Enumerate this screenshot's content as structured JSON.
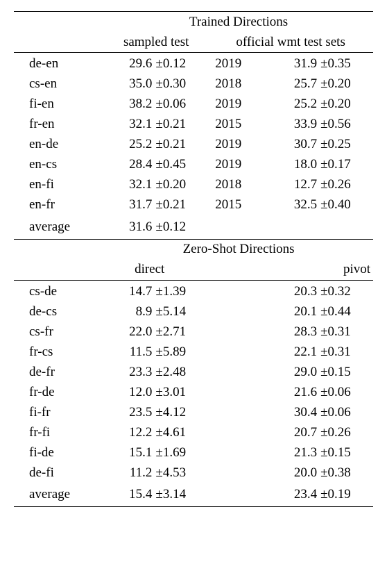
{
  "trained": {
    "title": "Trained Directions",
    "col_sampled": "sampled test",
    "col_official": "official wmt test sets",
    "rows": [
      {
        "pair": "de-en",
        "sv": "29.6",
        "se": "±0.12",
        "yr": "2019",
        "ov": "31.9",
        "oe": "±0.35"
      },
      {
        "pair": "cs-en",
        "sv": "35.0",
        "se": "±0.30",
        "yr": "2018",
        "ov": "25.7",
        "oe": "±0.20"
      },
      {
        "pair": "fi-en",
        "sv": "38.2",
        "se": "±0.06",
        "yr": "2019",
        "ov": "25.2",
        "oe": "±0.20"
      },
      {
        "pair": "fr-en",
        "sv": "32.1",
        "se": "±0.21",
        "yr": "2015",
        "ov": "33.9",
        "oe": "±0.56"
      },
      {
        "pair": "en-de",
        "sv": "25.2",
        "se": "±0.21",
        "yr": "2019",
        "ov": "30.7",
        "oe": "±0.25"
      },
      {
        "pair": "en-cs",
        "sv": "28.4",
        "se": "±0.45",
        "yr": "2019",
        "ov": "18.0",
        "oe": "±0.17"
      },
      {
        "pair": "en-fi",
        "sv": "32.1",
        "se": "±0.20",
        "yr": "2018",
        "ov": "12.7",
        "oe": "±0.26"
      },
      {
        "pair": "en-fr",
        "sv": "31.7",
        "se": "±0.21",
        "yr": "2015",
        "ov": "32.5",
        "oe": "±0.40"
      }
    ],
    "avg_label": "average",
    "avg_v": "31.6",
    "avg_e": "±0.12"
  },
  "zeroshot": {
    "title": "Zero-Shot Directions",
    "col_direct": "direct",
    "col_pivot": "pivot",
    "rows": [
      {
        "pair": "cs-de",
        "dv": "14.7",
        "de": "±1.39",
        "pv": "20.3",
        "pe": "±0.32"
      },
      {
        "pair": "de-cs",
        "dv": "8.9",
        "de": "±5.14",
        "pv": "20.1",
        "pe": "±0.44"
      },
      {
        "pair": "cs-fr",
        "dv": "22.0",
        "de": "±2.71",
        "pv": "28.3",
        "pe": "±0.31"
      },
      {
        "pair": "fr-cs",
        "dv": "11.5",
        "de": "±5.89",
        "pv": "22.1",
        "pe": "±0.31"
      },
      {
        "pair": "de-fr",
        "dv": "23.3",
        "de": "±2.48",
        "pv": "29.0",
        "pe": "±0.15"
      },
      {
        "pair": "fr-de",
        "dv": "12.0",
        "de": "±3.01",
        "pv": "21.6",
        "pe": "±0.06"
      },
      {
        "pair": "fi-fr",
        "dv": "23.5",
        "de": "±4.12",
        "pv": "30.4",
        "pe": "±0.06"
      },
      {
        "pair": "fr-fi",
        "dv": "12.2",
        "de": "±4.61",
        "pv": "20.7",
        "pe": "±0.26"
      },
      {
        "pair": "fi-de",
        "dv": "15.1",
        "de": "±1.69",
        "pv": "21.3",
        "pe": "±0.15"
      },
      {
        "pair": "de-fi",
        "dv": "11.2",
        "de": "±4.53",
        "pv": "20.0",
        "pe": "±0.38"
      }
    ],
    "avg_label": "average",
    "avg_dv": "15.4",
    "avg_de": "±3.14",
    "avg_pv": "23.4",
    "avg_pe": "±0.19"
  }
}
